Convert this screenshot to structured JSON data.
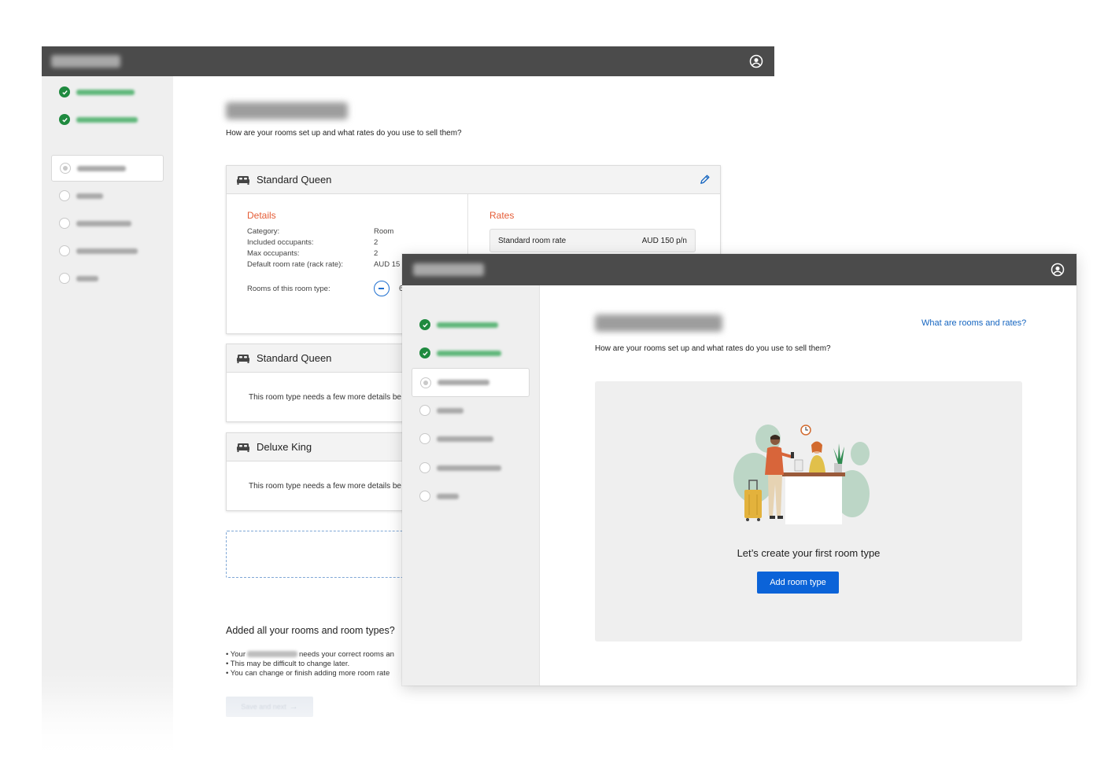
{
  "back_window": {
    "subtitle": "How are your rooms set up and what rates do you use to sell them?",
    "room_cards": [
      {
        "name": "Standard Queen",
        "details_title": "Details",
        "rates_title": "Rates",
        "details": [
          {
            "label": "Category:",
            "value": "Room"
          },
          {
            "label": "Included occupants:",
            "value": "2"
          },
          {
            "label": "Max occupants:",
            "value": "2"
          },
          {
            "label": "Default room rate (rack rate):",
            "value": "AUD 15"
          }
        ],
        "rooms_label": "Rooms of this room type:",
        "rooms_count": "6",
        "rate": {
          "name": "Standard room rate",
          "price": "AUD 150 p/n"
        }
      },
      {
        "name": "Standard Queen",
        "message": "This room type needs a few more details be"
      },
      {
        "name": "Deluxe King",
        "message": "This room type needs a few more details be"
      }
    ],
    "added_title": "Added all your rooms and room types?",
    "bullets": [
      {
        "prefix": "• Your",
        "suffix": "needs your correct rooms an"
      },
      {
        "text": "• This may be difficult to change later."
      },
      {
        "text": "• You can change or finish adding more room rate"
      }
    ],
    "save_label": "Save and next"
  },
  "front_window": {
    "help_link": "What are rooms and rates?",
    "subtitle": "How are your rooms set up and what rates do you use to sell them?",
    "empty_caption": "Let’s create your first room type",
    "add_button_label": "Add room type"
  },
  "steps": [
    {
      "status": "done"
    },
    {
      "status": "done"
    },
    {
      "status": "current"
    },
    {
      "status": "todo"
    },
    {
      "status": "todo"
    },
    {
      "status": "todo"
    },
    {
      "status": "todo"
    }
  ],
  "colors": {
    "topbar": "#4b4b4b",
    "accent_blue": "#0b63d8",
    "done_green": "#1f8a3f",
    "section_orange": "#e55c36"
  },
  "icons": [
    "user-circle-icon",
    "bed-icon",
    "pencil-icon",
    "check-icon",
    "arrow-right-icon"
  ]
}
